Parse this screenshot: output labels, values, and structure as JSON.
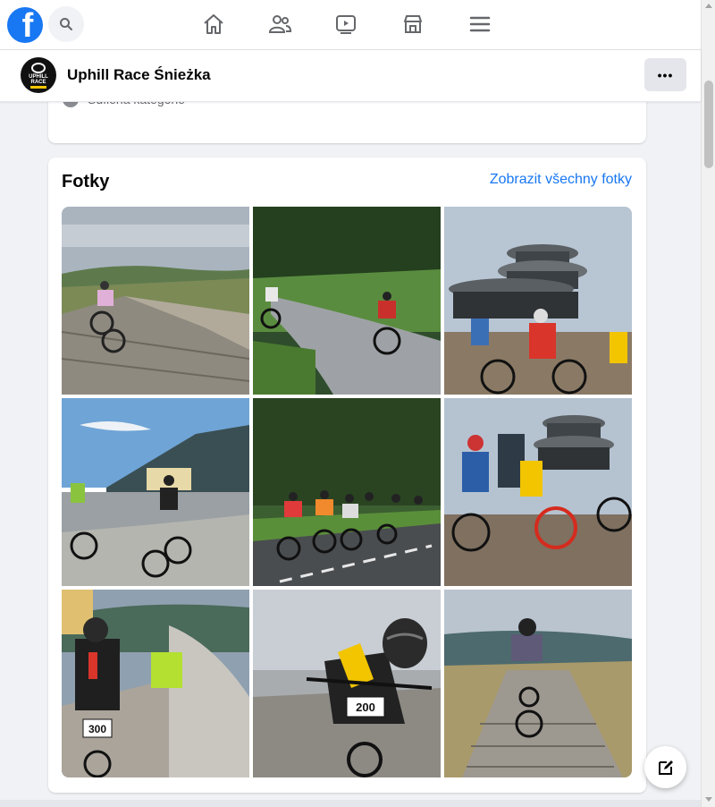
{
  "topnav": {
    "logo_letter": "f",
    "icons": [
      "search-icon",
      "home-icon",
      "friends-icon",
      "watch-icon",
      "marketplace-icon",
      "menu-icon"
    ]
  },
  "page": {
    "name": "Uphill Race Śnieżka",
    "avatar_text_1": "UPHILL",
    "avatar_text_2": "RACE",
    "more_label": "•••"
  },
  "about": {
    "row_text": "Sdílená kategorie · "
  },
  "photos": {
    "title": "Fotky",
    "see_all_label": "Zobrazit všechny fotky",
    "items": [
      {
        "bib": ""
      },
      {
        "bib": ""
      },
      {
        "bib": ""
      },
      {
        "bib": ""
      },
      {
        "bib": ""
      },
      {
        "bib": ""
      },
      {
        "bib": "300"
      },
      {
        "bib": "200"
      },
      {
        "bib": ""
      }
    ]
  },
  "colors": {
    "brand": "#1877f2",
    "background": "#f0f2f5",
    "card": "#ffffff",
    "text_secondary": "#65676b"
  }
}
